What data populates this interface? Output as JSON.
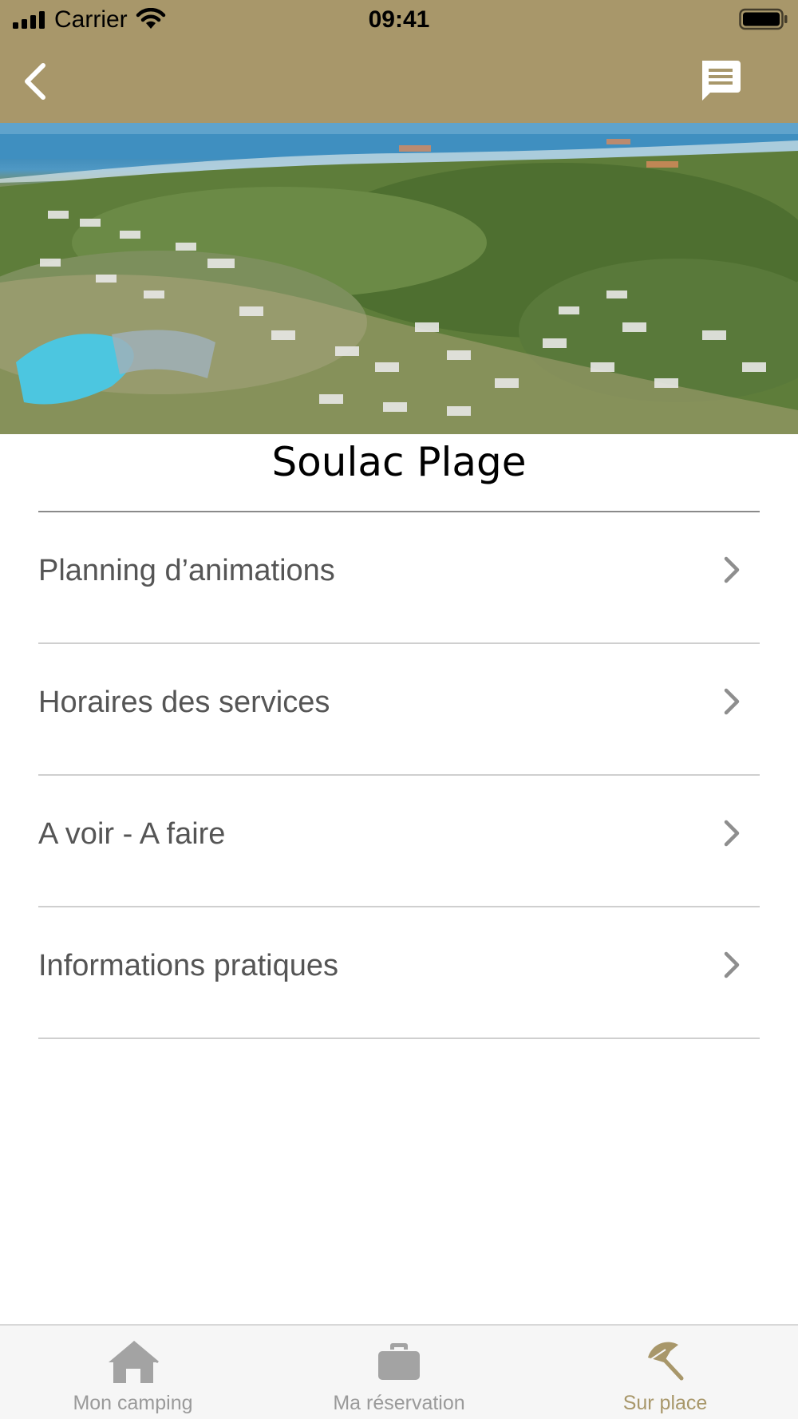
{
  "status_bar": {
    "carrier": "Carrier",
    "time": "09:41"
  },
  "nav": {
    "back_icon": "chevron-left-icon",
    "action_icon": "message-icon"
  },
  "colors": {
    "brand": "#a8976a",
    "tab_inactive": "#9a9a9a",
    "menu_text": "#555555"
  },
  "page": {
    "title": "Soulac Plage"
  },
  "menu": {
    "items": [
      {
        "label": "Planning d’animations"
      },
      {
        "label": "Horaires des services"
      },
      {
        "label": "A voir - A faire"
      },
      {
        "label": "Informations pratiques"
      }
    ]
  },
  "tabs": [
    {
      "label": "Mon camping",
      "icon": "home-icon",
      "active": false
    },
    {
      "label": "Ma réservation",
      "icon": "briefcase-icon",
      "active": false
    },
    {
      "label": "Sur place",
      "icon": "beach-umbrella-icon",
      "active": true
    }
  ]
}
